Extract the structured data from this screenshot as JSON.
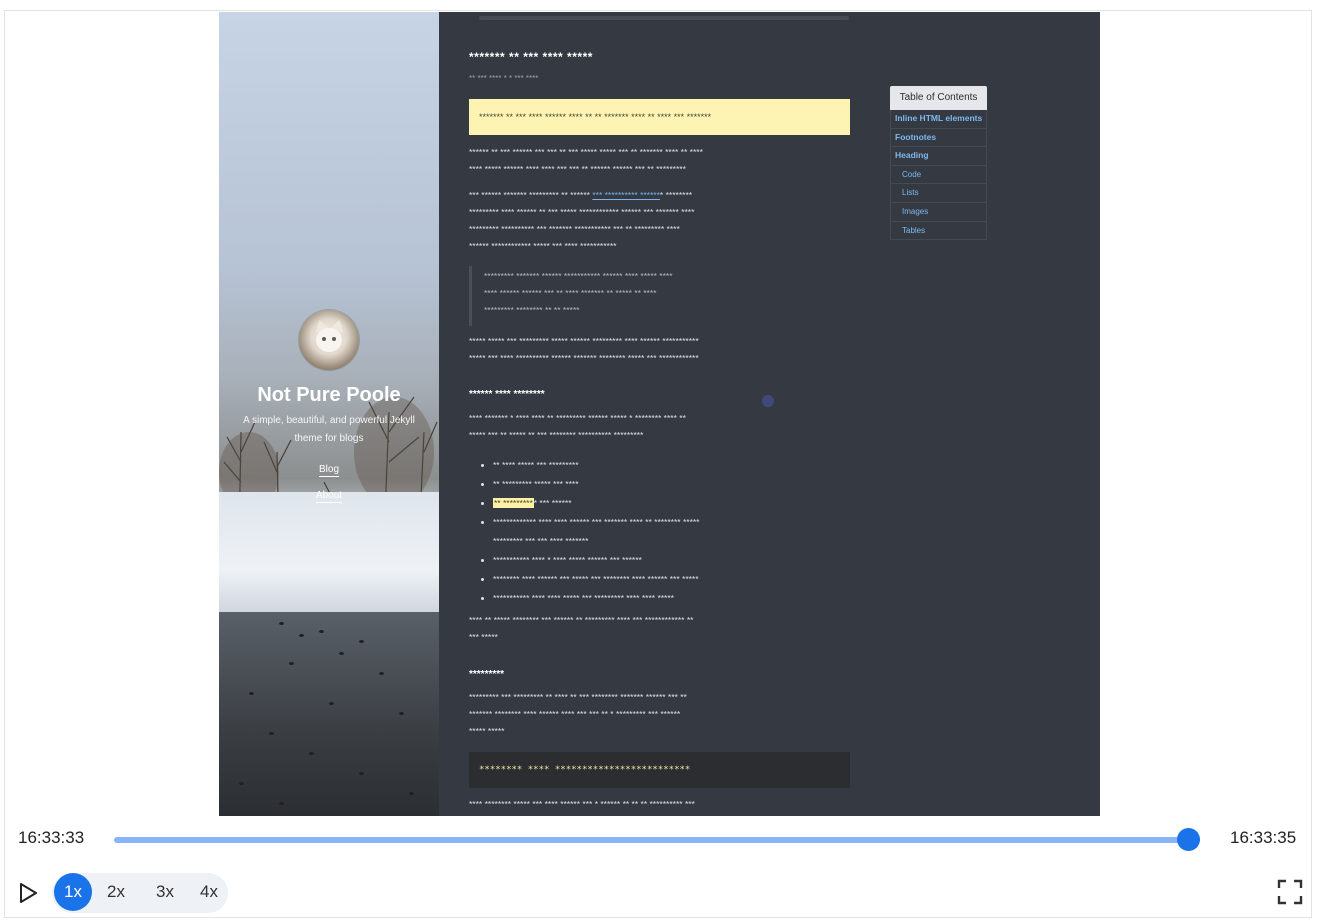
{
  "site": {
    "title": "Not Pure Poole",
    "description": "A simple, beautiful, and powerful Jekyll theme for blogs",
    "nav": [
      "Blog",
      "About"
    ]
  },
  "post": {
    "title": "******* ** *** **** *****",
    "date": "** *** **** * * *** ****",
    "notice": "******* ** *** **** ****** **** ** ** ******* **** ** **** *** *******",
    "para1": "****** ** *** ****** *** *** ** *** ***** ***** *** ** ******* **** ** ****\n**** ***** ****** **** **** *** *** ** ****** ****** *** ** *********",
    "para2_start": "*** ****** ******* ********* ** ****** ",
    "para2_link": "*** ********** ******",
    "para2_end": "* ********\n********* **** ****** ** *** ***** ************ ****** *** ******* ****\n********* ********** *** ******* *********** *** ** ********* ****\n****** ************ ***** *** **** ***********",
    "quote": "********* ******* ****** *********** ****** **** ***** ****\n**** ****** ****** *** ** **** ******* ** ***** ** ****\n********* ******** ** ** *****",
    "para3": "***** ***** *** ********* ***** ****** ********* **** ****** ***********\n***** *** **** ********** ****** ******* ******** ***** *** ************",
    "heading_lists": "****** **** ********",
    "para4": "**** ******* * **** **** ** ********* ****** ***** * ******** **** **\n***** *** ** ***** ** *** ******** ********** *********",
    "list": [
      "** **** ***** *** *********",
      "** ********* ***** *** ****",
      "** *********",
      "************* **** **** ****** *** ******* **** ** ******** *****\n********* *** *** **** *******",
      "*********** **** * **** ***** ****** *** ******",
      "******** **** ****** *** ***** *** ******** **** ****** *** *****",
      "*********** **** **** ***** *** ********* **** **** *****"
    ],
    "list_hl_suffix": "* *** ******",
    "para5": "**** ** ***** ******** *** ****** ** ********* **** *** ************ **\n*** *****",
    "heading_code": "*********",
    "para6": "********* *** ********* ** **** ** *** ******** ******* ****** *** **\n******* ******** **** ****** **** *** *** ** * ********* *** ******\n***** *****",
    "code": "******** ****  *************************",
    "para7": "**** ******** ***** *** **** ****** *** * ****** ** ** ** ********** ***"
  },
  "toc": {
    "title": "Table of Contents",
    "items": [
      {
        "label": "Inline HTML elements",
        "level": 1
      },
      {
        "label": "Footnotes",
        "level": 1
      },
      {
        "label": "Heading",
        "level": 1
      },
      {
        "label": "Code",
        "level": 2
      },
      {
        "label": "Lists",
        "level": 2
      },
      {
        "label": "Images",
        "level": 2
      },
      {
        "label": "Tables",
        "level": 2
      }
    ]
  },
  "player": {
    "start_time": "16:33:33",
    "end_time": "16:33:35",
    "progress": 1.0,
    "speeds": [
      "1x",
      "2x",
      "3x",
      "4x"
    ],
    "active_speed": "1x",
    "colors": {
      "accent": "#1a73e8",
      "track": "#8ab4f8"
    }
  }
}
